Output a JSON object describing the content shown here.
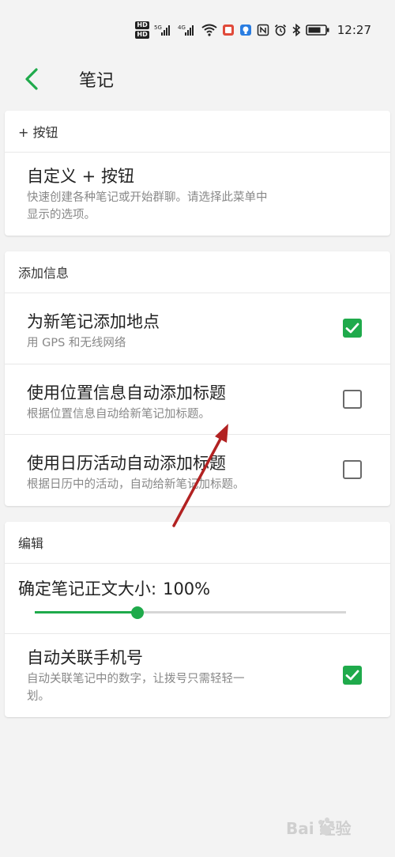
{
  "status_bar": {
    "time": "12:27",
    "hd1": "HD",
    "hd2": "HD",
    "net1": "5G",
    "net2": "4G",
    "icons": [
      "hd-icon",
      "signal-5g-icon",
      "signal-4g-icon",
      "wifi-icon",
      "notification-red-icon",
      "notification-blue-icon",
      "nfc-icon",
      "alarm-icon",
      "bluetooth-icon",
      "battery-icon"
    ]
  },
  "app_bar": {
    "title": "笔记",
    "back_icon": "chevron-left-icon",
    "accent_color": "#1faa4b"
  },
  "section_button": {
    "header": "+ 按钮",
    "custom": {
      "title": "自定义 + 按钮",
      "subtitle_line1": "快速创建各种笔记或开始群聊。请选择此菜单中",
      "subtitle_line2": "显示的选项。"
    }
  },
  "section_info": {
    "header": "添加信息",
    "items": [
      {
        "title": "为新笔记添加地点",
        "subtitle": "用 GPS 和无线网络",
        "checked": true
      },
      {
        "title": "使用位置信息自动添加标题",
        "subtitle": "根据位置信息自动给新笔记加标题。",
        "checked": false
      },
      {
        "title": "使用日历活动自动添加标题",
        "subtitle": "根据日历中的活动，自动给新笔记加标题。",
        "checked": false
      }
    ]
  },
  "section_edit": {
    "header": "编辑",
    "font_size": {
      "label": "确定笔记正文大小:",
      "value_text": "100%",
      "slider_fraction": 0.33
    },
    "auto_link": {
      "title": "自动关联手机号",
      "subtitle_line1": "自动关联笔记中的数字，让拨号只需轻轻一",
      "subtitle_line2": "划。",
      "checked": true
    }
  },
  "watermark": {
    "text": "Bai 经验",
    "icon": "baidu-paw-icon"
  }
}
